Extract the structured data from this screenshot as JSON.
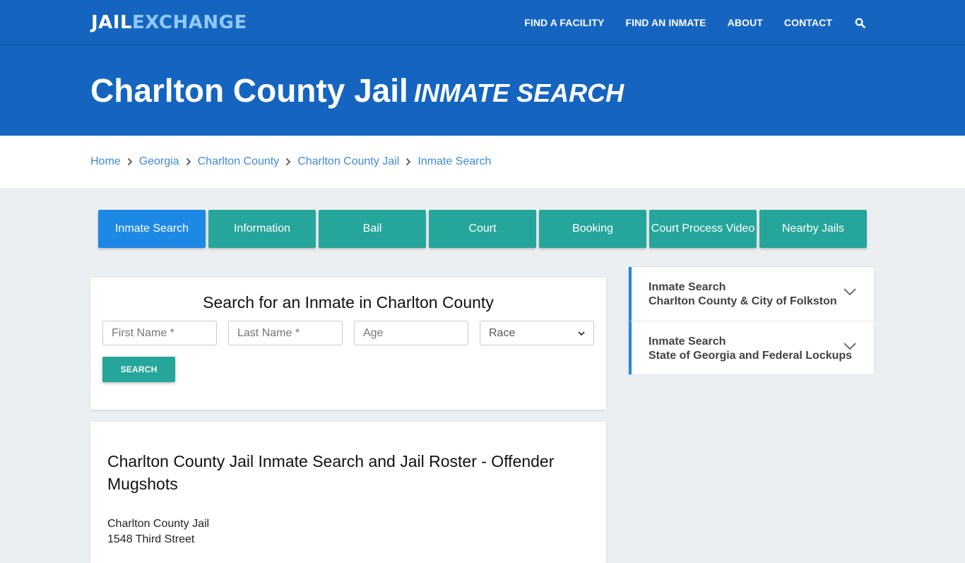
{
  "brand": {
    "part1": "JAIL",
    "part2": "EXCHANGE"
  },
  "nav": {
    "links": [
      "FIND A FACILITY",
      "FIND AN INMATE",
      "ABOUT",
      "CONTACT"
    ],
    "search_icon": "search-icon"
  },
  "hero": {
    "title": "Charlton County Jail",
    "subtitle": "INMATE SEARCH"
  },
  "breadcrumb": [
    "Home",
    "Georgia",
    "Charlton County",
    "Charlton County Jail",
    "Inmate Search"
  ],
  "tabs": [
    {
      "label": "Inmate Search",
      "active": true
    },
    {
      "label": "Information"
    },
    {
      "label": "Bail"
    },
    {
      "label": "Court"
    },
    {
      "label": "Booking"
    },
    {
      "label": "Court Process Video"
    },
    {
      "label": "Nearby Jails"
    }
  ],
  "search_form": {
    "heading": "Search for an Inmate in Charlton County",
    "first_name_placeholder": "First Name *",
    "last_name_placeholder": "Last Name *",
    "age_placeholder": "Age",
    "race_selected": "Race",
    "submit_label": "SEARCH"
  },
  "article": {
    "heading": "Charlton County Jail Inmate Search and Jail Roster - Offender Mugshots",
    "address_line1": "Charlton County Jail",
    "address_line2": "1548 Third Street"
  },
  "sidebar": {
    "items": [
      {
        "line1": "Inmate Search",
        "line2": "Charlton County & City of Folkston"
      },
      {
        "line1": "Inmate Search",
        "line2": "State of Georgia and Federal Lockups"
      }
    ]
  },
  "colors": {
    "primary_blue": "#1565c0",
    "active_tab": "#1e88e5",
    "teal": "#26a69a",
    "link": "#3f8ad8",
    "logo_accent": "#90caf9"
  }
}
